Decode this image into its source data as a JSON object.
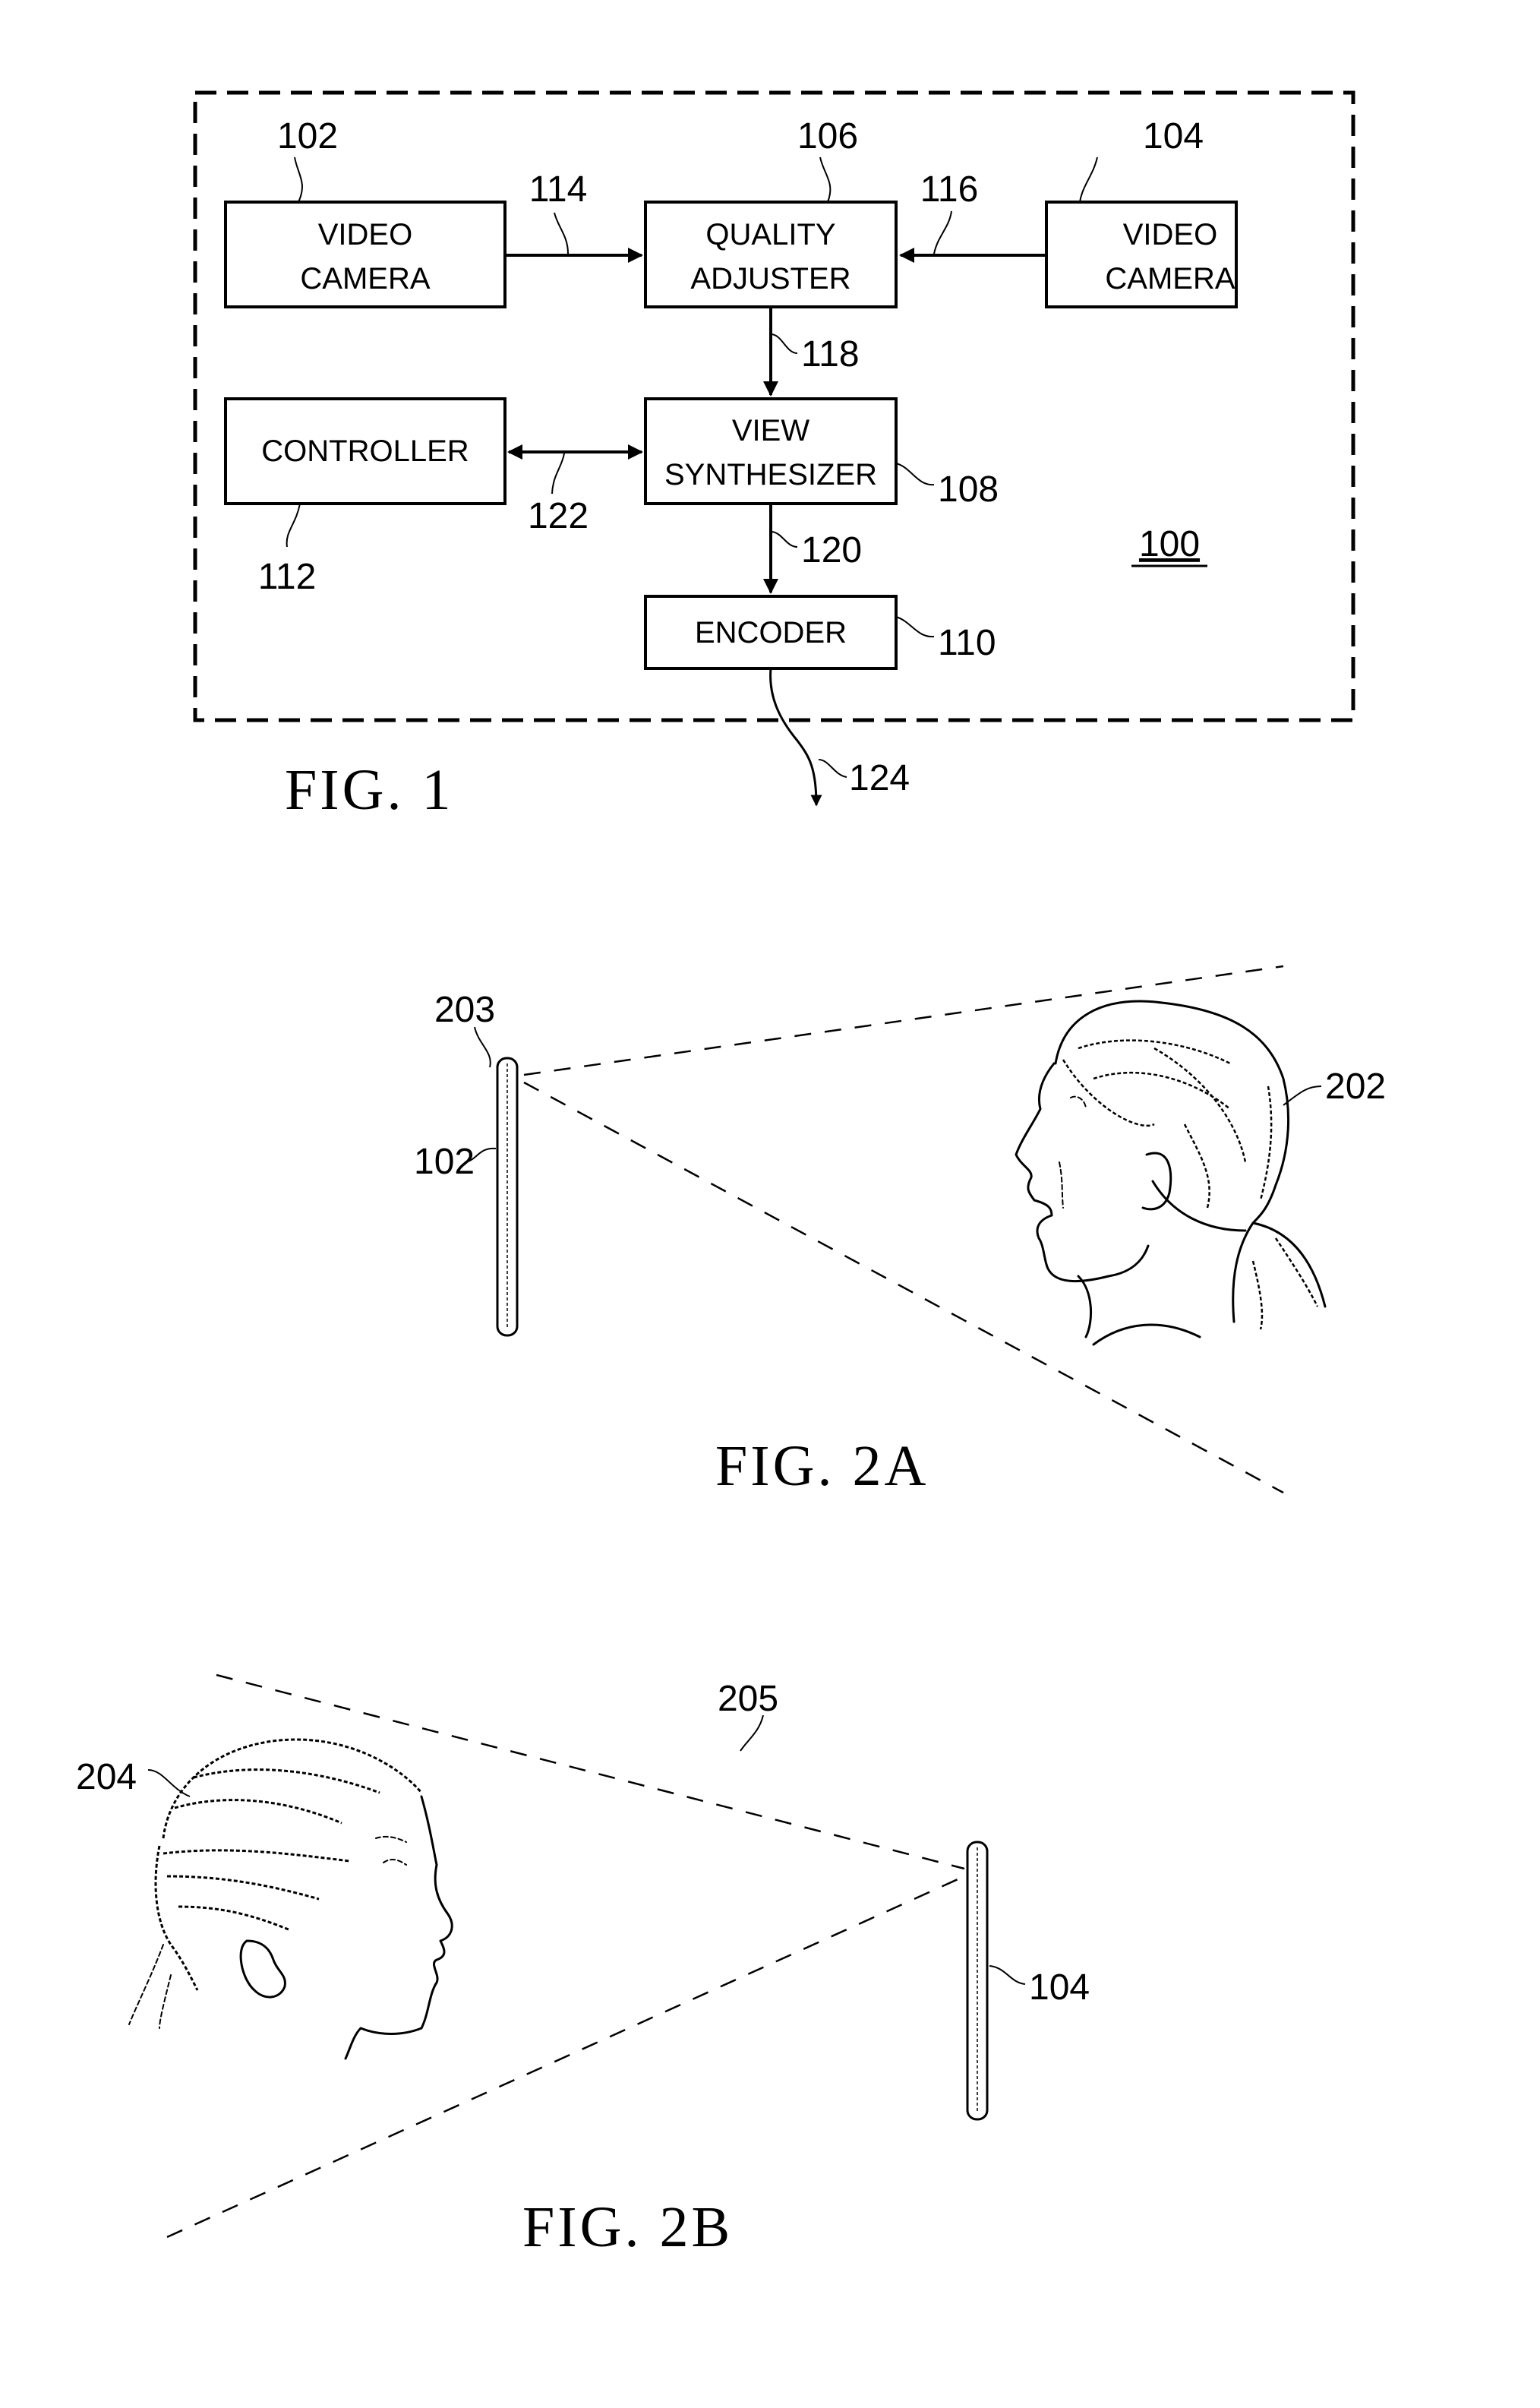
{
  "figure1": {
    "caption": "FIG. 1",
    "system_ref": "100",
    "blocks": {
      "camera_left": {
        "line1": "VIDEO",
        "line2": "CAMERA",
        "ref": "102"
      },
      "quality_adjuster": {
        "line1": "QUALITY",
        "line2": "ADJUSTER",
        "ref": "106"
      },
      "camera_right": {
        "line1": "VIDEO",
        "line2": "CAMERA",
        "ref": "104"
      },
      "controller": {
        "line1": "CONTROLLER",
        "ref": "112"
      },
      "view_synthesizer": {
        "line1": "VIEW",
        "line2": "SYNTHESIZER",
        "ref": "108"
      },
      "encoder": {
        "line1": "ENCODER",
        "ref": "110"
      }
    },
    "connections": {
      "camera_left_to_adjuster": "114",
      "camera_right_to_adjuster": "116",
      "adjuster_to_synthesizer": "118",
      "synthesizer_to_encoder": "120",
      "controller_synthesizer": "122",
      "encoder_output": "124"
    }
  },
  "figure2a": {
    "caption": "FIG. 2A",
    "camera_ref": "102",
    "field_of_view_ref": "203",
    "subject_ref": "202"
  },
  "figure2b": {
    "caption": "FIG. 2B",
    "camera_ref": "104",
    "field_of_view_ref": "205",
    "subject_ref": "204"
  }
}
